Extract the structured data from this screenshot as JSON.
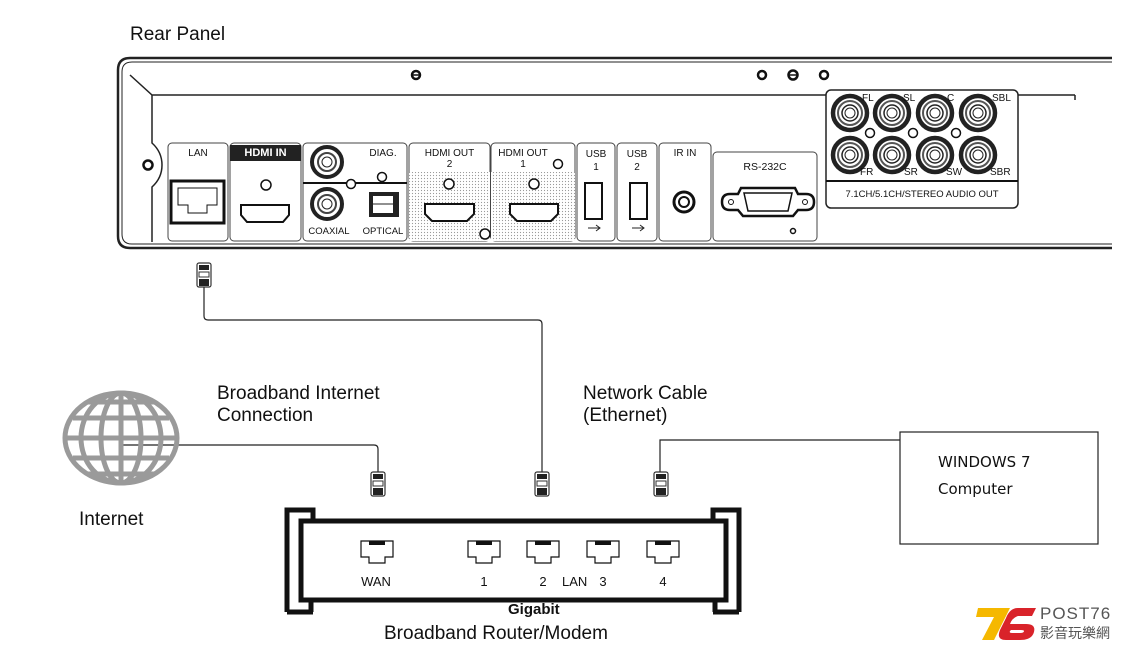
{
  "title": "Rear Panel",
  "rear_panel": {
    "ports": {
      "lan": "LAN",
      "hdmi_in": "HDMI IN",
      "diag": "DIAG.",
      "coaxial": "COAXIAL",
      "optical": "OPTICAL",
      "hdmi_out_2_line1": "HDMI OUT",
      "hdmi_out_2_line2": "2",
      "hdmi_out_1_line1": "HDMI OUT",
      "hdmi_out_1_line2": "1",
      "usb1_line1": "USB",
      "usb1_line2": "1",
      "usb2_line1": "USB",
      "usb2_line2": "2",
      "ir_in": "IR IN",
      "rs232c": "RS-232C"
    },
    "audio": {
      "channels_top": [
        "FL",
        "SL",
        "C",
        "SBL"
      ],
      "channels_bottom": [
        "FR",
        "SR",
        "SW",
        "SBR"
      ],
      "caption": "7.1CH/5.1CH/STEREO AUDIO OUT"
    }
  },
  "labels": {
    "broadband_line1": "Broadband Internet",
    "broadband_line2": "Connection",
    "network_line1": "Network Cable",
    "network_line2": "(Ethernet)",
    "internet": "Internet"
  },
  "router": {
    "wan": "WAN",
    "lan_ports": [
      "1",
      "2",
      "3",
      "4"
    ],
    "lan_label": "LAN",
    "gigabit": "Gigabit",
    "name": "Broadband Router/Modem"
  },
  "computer": {
    "line1": "WINDOWS 7",
    "line2": "Computer"
  },
  "logo": {
    "number": "76",
    "brand": "POST76",
    "chinese": "影音玩樂網",
    "colors": {
      "seven": "#f5b800",
      "six": "#d9232a",
      "text": "#555555"
    }
  }
}
